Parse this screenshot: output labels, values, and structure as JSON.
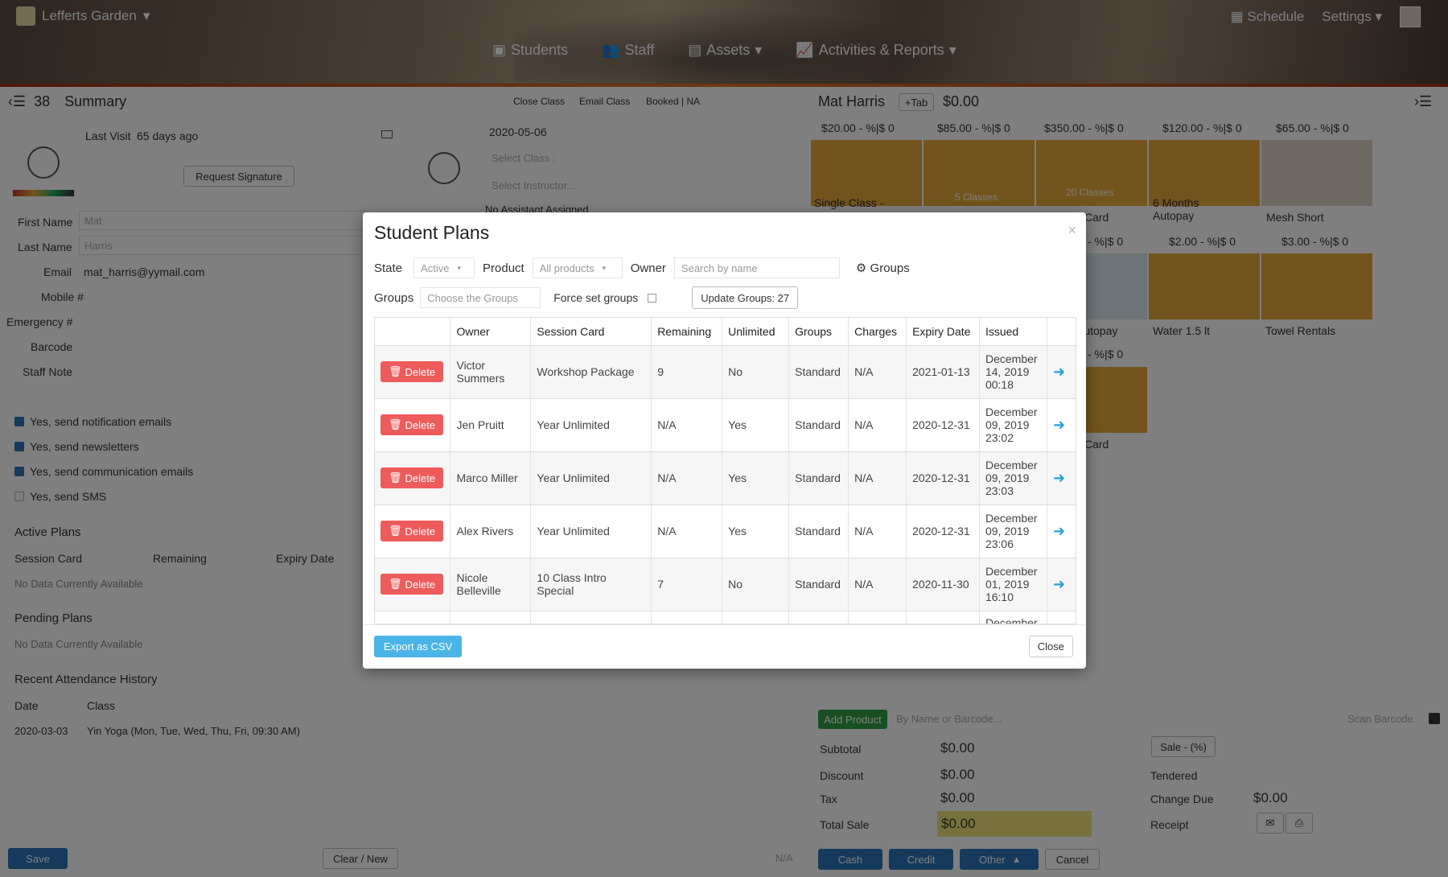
{
  "header": {
    "location": "Lefferts Garden",
    "schedule_label": "Schedule",
    "settings_label": "Settings",
    "nav": [
      "Students",
      "Staff",
      "Assets",
      "Activities & Reports"
    ]
  },
  "left_panel": {
    "count": "38",
    "title": "Summary",
    "last_visit_label": "Last Visit",
    "last_visit_value": "65 days ago",
    "request_signature": "Request Signature",
    "fields": {
      "first_name_label": "First Name",
      "first_name_value": "Mat",
      "last_name_label": "Last Name",
      "last_name_value": "Harris",
      "email_label": "Email",
      "email_value": "mat_harris@yymail.com",
      "mobile_label": "Mobile #",
      "emergency_label": "Emergency #",
      "barcode_label": "Barcode",
      "staff_note_label": "Staff Note"
    },
    "checkboxes": [
      {
        "label": "Yes, send notification emails",
        "checked": true
      },
      {
        "label": "Yes, send newsletters",
        "checked": true
      },
      {
        "label": "Yes, send communication emails",
        "checked": true
      },
      {
        "label": "Yes, send SMS",
        "checked": false
      }
    ],
    "active_plans": "Active Plans",
    "cols": [
      "Session Card",
      "Remaining",
      "Expiry Date"
    ],
    "no_data": "No Data Currently Available",
    "pending_plans": "Pending Plans",
    "attendance": "Recent Attendance History",
    "att_cols": [
      "Date",
      "Class"
    ],
    "att_date": "2020-03-03",
    "att_class": "Yin Yoga (Mon, Tue, Wed, Thu, Fri, 09:30 AM)",
    "save": "Save",
    "clear_new": "Clear / New"
  },
  "middle_panel": {
    "tabs": [
      "Close Class",
      "Email Class",
      "Booked | NA"
    ],
    "date": "2020-05-06",
    "select_class": "Select Class :",
    "select_instructor": "Select Instructor...",
    "no_assistant": "No Assistant Assigned",
    "na": "N/A"
  },
  "right_panel": {
    "customer": "Mat Harris",
    "tab_label": "Tab",
    "balance": "$0.00",
    "row1_prices": [
      "$20.00",
      "$85.00",
      "$350.00",
      "$120.00",
      "$65.00"
    ],
    "row1_names": [
      "Single Class -",
      "5 Classes",
      "20 Classes",
      "6 Months Autopay",
      "Mesh Short"
    ],
    "row2_prices": [
      "$2.00",
      "$3.00"
    ],
    "row2_names": [
      "Water 1.5 lt",
      "Towel Rentals"
    ],
    "discount_label": "- %|$",
    "qty": "0",
    "frag_card": "Card",
    "frag_autopay": "Autopay",
    "add_product": "Add Product",
    "search_placeholder": "By Name or Barcode...",
    "scan_barcode": "Scan Barcode",
    "subtotal_label": "Subtotal",
    "subtotal": "$0.00",
    "discount_label2": "Discount",
    "discount": "$0.00",
    "tax_label": "Tax",
    "tax": "$0.00",
    "total_label": "Total Sale",
    "total": "$0.00",
    "sale_btn": "Sale - (%)",
    "tendered": "Tendered",
    "change_due_label": "Change Due",
    "change_due": "$0.00",
    "receipt": "Receipt",
    "pay_buttons": [
      "Cash",
      "Credit",
      "Other"
    ],
    "cancel": "Cancel"
  },
  "modal": {
    "title": "Student Plans",
    "state_label": "State",
    "state_value": "Active",
    "product_label": "Product",
    "product_value": "All products",
    "owner_label": "Owner",
    "owner_placeholder": "Search by name",
    "groups_link": "Groups",
    "groups_label": "Groups",
    "groups_placeholder": "Choose the Groups",
    "force_label": "Force set groups",
    "update_btn": "Update Groups: 27",
    "columns": [
      "",
      "Owner",
      "Session Card",
      "Remaining",
      "Unlimited",
      "Groups",
      "Charges",
      "Expiry Date",
      "Issued",
      ""
    ],
    "delete_label": "Delete",
    "rows": [
      {
        "owner": "Victor Summers",
        "card": "Workshop Package",
        "remaining": "9",
        "unlimited": "No",
        "groups": "Standard",
        "charges": "N/A",
        "expiry": "2021-01-13",
        "issued": "December 14, 2019 00:18"
      },
      {
        "owner": "Jen Pruitt",
        "card": "Year Unlimited",
        "remaining": "N/A",
        "unlimited": "Yes",
        "groups": "Standard",
        "charges": "N/A",
        "expiry": "2020-12-31",
        "issued": "December 09, 2019 23:02"
      },
      {
        "owner": "Marco Miller",
        "card": "Year Unlimited",
        "remaining": "N/A",
        "unlimited": "Yes",
        "groups": "Standard",
        "charges": "N/A",
        "expiry": "2020-12-31",
        "issued": "December 09, 2019 23:03"
      },
      {
        "owner": "Alex Rivers",
        "card": "Year Unlimited",
        "remaining": "N/A",
        "unlimited": "Yes",
        "groups": "Standard",
        "charges": "N/A",
        "expiry": "2020-12-31",
        "issued": "December 09, 2019 23:06"
      },
      {
        "owner": "Nicole Belleville",
        "card": "10 Class Intro Special",
        "remaining": "7",
        "unlimited": "No",
        "groups": "Standard",
        "charges": "N/A",
        "expiry": "2020-11-30",
        "issued": "December 01, 2019 16:10"
      },
      {
        "owner": "",
        "card": "",
        "remaining": "",
        "unlimited": "",
        "groups": "",
        "charges": "",
        "expiry": "",
        "issued": "December"
      }
    ],
    "export": "Export as CSV",
    "close": "Close"
  },
  "colors": {
    "delete": "#ee5b5b",
    "export": "#4ab4e6",
    "arrow": "#2a9fd6",
    "tile": "#e6a83a",
    "save": "#2b75b8",
    "add_product": "#2f9e44"
  }
}
